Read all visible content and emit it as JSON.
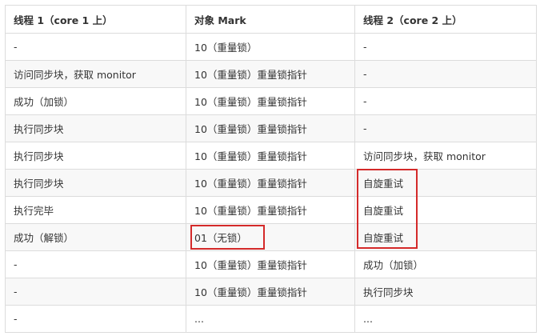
{
  "headers": [
    "线程 1（core 1 上）",
    "对象 Mark",
    "线程 2（core 2 上）"
  ],
  "rows": [
    [
      "-",
      "10（重量锁）",
      "-"
    ],
    [
      "访问同步块，获取 monitor",
      "10（重量锁）重量锁指针",
      "-"
    ],
    [
      "成功（加锁）",
      "10（重量锁）重量锁指针",
      "-"
    ],
    [
      "执行同步块",
      "10（重量锁）重量锁指针",
      "-"
    ],
    [
      "执行同步块",
      "10（重量锁）重量锁指针",
      "访问同步块，获取 monitor"
    ],
    [
      "执行同步块",
      "10（重量锁）重量锁指针",
      "自旋重试"
    ],
    [
      "执行完毕",
      "10（重量锁）重量锁指针",
      "自旋重试"
    ],
    [
      "成功（解锁）",
      "01（无锁）",
      "自旋重试"
    ],
    [
      "-",
      "10（重量锁）重量锁指针",
      "成功（加锁）"
    ],
    [
      "-",
      "10（重量锁）重量锁指针",
      "执行同步块"
    ],
    [
      "-",
      "...",
      "..."
    ]
  ],
  "highlight_color": "#d42a2a"
}
